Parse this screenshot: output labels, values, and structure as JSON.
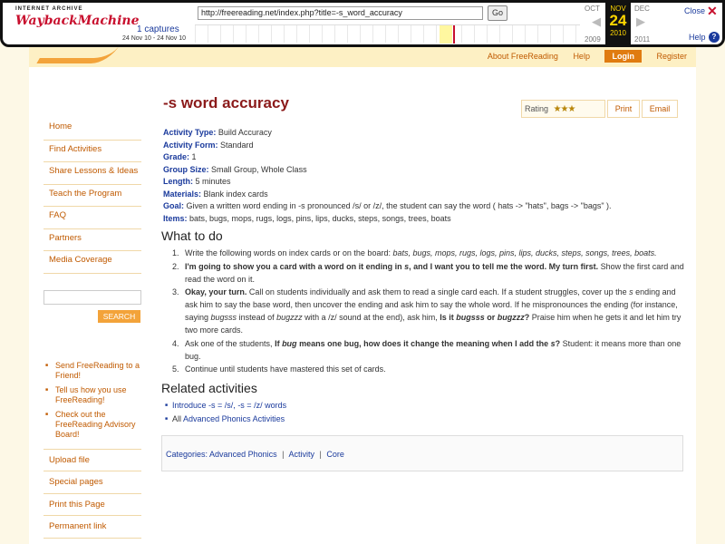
{
  "wayback": {
    "logo_line1": "INTERNET ARCHIVE",
    "logo_line2": "WaybackMachine",
    "url": "http://freereading.net/index.php?title=-s_word_accuracy",
    "go_label": "Go",
    "captures": "1 captures",
    "range": "24 Nov 10 - 24 Nov 10",
    "prev_month": "OCT",
    "cur_month": "NOV",
    "next_month": "DEC",
    "cur_day": "24",
    "prev_year": "2009",
    "cur_year": "2010",
    "next_year": "2011",
    "close_label": "Close",
    "help_label": "Help"
  },
  "topnav": {
    "about": "About FreeReading",
    "help": "Help",
    "login": "Login",
    "register": "Register"
  },
  "sidebar": {
    "nav": [
      "Home",
      "Find Activities",
      "Share Lessons & Ideas",
      "Teach the Program",
      "FAQ",
      "Partners",
      "Media Coverage"
    ],
    "search_label": "SEARCH",
    "links": [
      "Send FreeReading to a Friend!",
      "Tell us how you use FreeReading!",
      "Check out the FreeReading Advisory Board!"
    ],
    "tools": [
      "Upload file",
      "Special pages",
      "Print this Page",
      "Permanent link"
    ]
  },
  "page": {
    "title": "-s word accuracy",
    "rating_label": "Rating",
    "rating_stars": 3,
    "print_label": "Print",
    "email_label": "Email",
    "details": [
      {
        "key": "Activity Type:",
        "val": "Build Accuracy"
      },
      {
        "key": "Activity Form:",
        "val": "Standard"
      },
      {
        "key": "Grade:",
        "val": "1"
      },
      {
        "key": "Group Size:",
        "val": "Small Group, Whole Class"
      },
      {
        "key": "Length:",
        "val": "5 minutes"
      },
      {
        "key": "Materials:",
        "val": "Blank index cards"
      },
      {
        "key": "Goal:",
        "val": "Given a written word ending in -s pronounced /s/ or /z/, the student can say the word ( hats -> \"hats\", bags -> \"bags\" )."
      },
      {
        "key": "Items:",
        "val": "bats, bugs, mops, rugs, logs, pins, lips, ducks, steps, songs, trees, boats"
      }
    ],
    "what_title": "What to do",
    "steps": {
      "s1_a": "Write the following words on index cards or on the board: ",
      "s1_b": "bats, bugs, mops, rugs, logs, pins, lips, ducks, steps, songs, trees, boats.",
      "s2_a": "I'm going to show you a card with a word on it ending in ",
      "s2_b": "s",
      "s2_c": ", and I want you to tell me the word. My turn first.",
      "s2_d": " Show the first card and read the word on it.",
      "s3_a": "Okay, your turn.",
      "s3_b": " Call on students individually and ask them to read a single card each. If a student struggles, cover up the ",
      "s3_c": "s",
      "s3_d": " ending and ask him to say the base word, then uncover the ending and ask him to say the whole word. If he mispronounces the ending (for instance, saying ",
      "s3_e": "bugsss",
      "s3_f": " instead of ",
      "s3_g": "bugzzz",
      "s3_h": " with a /z/ sound at the end), ask him, ",
      "s3_i": "Is it ",
      "s3_j": "bugsss",
      "s3_k": " or ",
      "s3_l": "bugzzz",
      "s3_m": "?",
      "s3_n": " Praise him when he gets it and let him try two more cards.",
      "s4_a": "Ask one of the students, ",
      "s4_b": "If ",
      "s4_c": "bug",
      "s4_d": " means one bug, how does it change the meaning when I add the ",
      "s4_e": "s",
      "s4_f": "?",
      "s4_g": " Student: it means more than one bug.",
      "s5": "Continue until students have mastered this set of cards."
    },
    "related_title": "Related activities",
    "related": {
      "r1": "Introduce -s = /s/, -s = /z/ words",
      "r2_prefix": "All ",
      "r2_link": "Advanced Phonics Activities"
    },
    "categories": {
      "label": "Categories:",
      "c1": "Advanced Phonics",
      "c2": "Activity",
      "c3": "Core",
      "sep": "|"
    }
  }
}
